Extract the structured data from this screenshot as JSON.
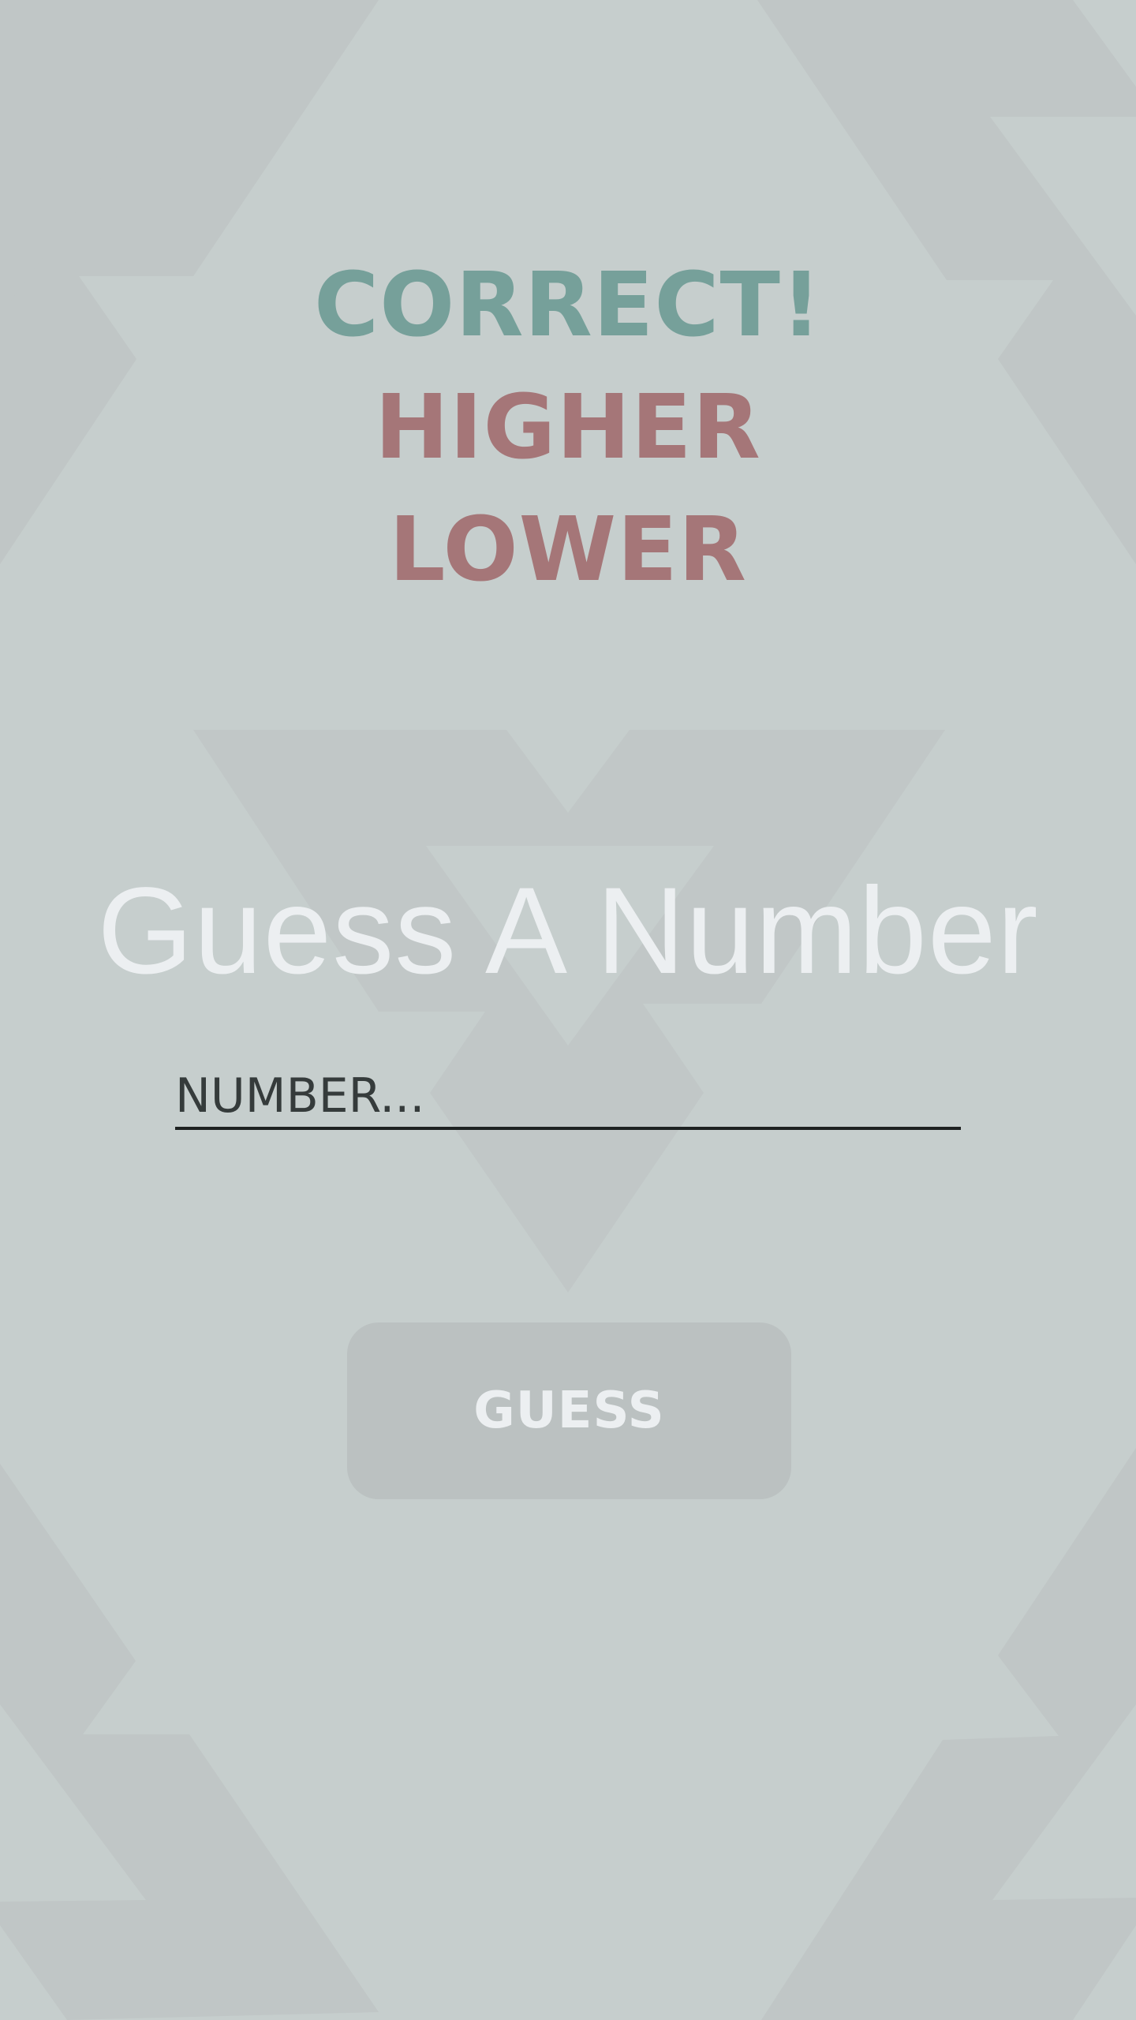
{
  "status": {
    "correct_label": "CORRECT!",
    "higher_label": "HIGHER",
    "lower_label": "LOWER"
  },
  "title": "Guess A Number",
  "number_input": {
    "value": "",
    "placeholder": "NUMBER..."
  },
  "guess_button": {
    "label": "GUESS"
  },
  "colors": {
    "background": "#c6cecd",
    "pattern": "#bbc1c1",
    "correct": "#76a09a",
    "higher_lower": "#a57678",
    "title": "#eceff1",
    "input_underline": "#1e2222",
    "button_background": "#bbc1c1",
    "button_text": "#eceff1"
  }
}
